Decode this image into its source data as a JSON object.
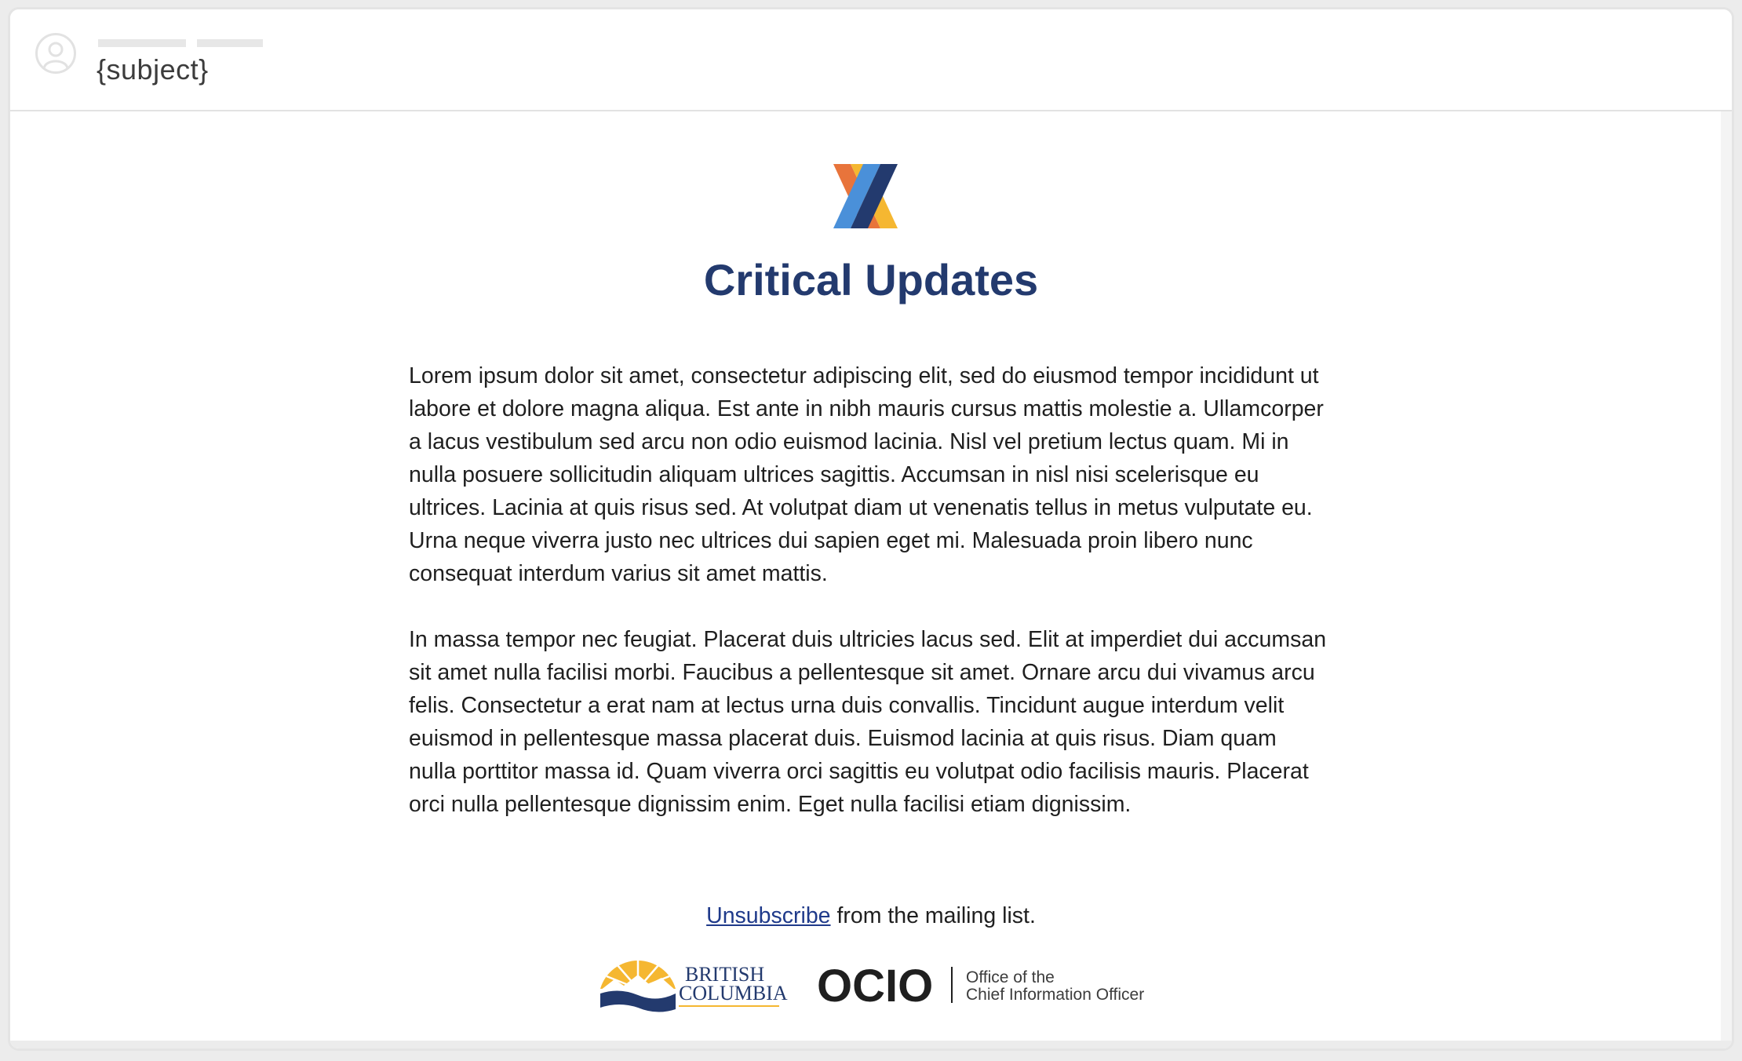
{
  "email": {
    "subject": "{subject}"
  },
  "content": {
    "title": "Critical Updates",
    "paragraphs": [
      "Lorem ipsum dolor sit amet, consectetur adipiscing elit, sed do eiusmod tempor incididunt ut labore et dolore magna aliqua. Est ante in nibh mauris cursus mattis molestie a. Ullamcorper a lacus vestibulum sed arcu non odio euismod lacinia. Nisl vel pretium lectus quam. Mi in nulla posuere sollicitudin aliquam ultrices sagittis. Accumsan in nisl nisi scelerisque eu ultrices. Lacinia at quis risus sed. At volutpat diam ut venenatis tellus in metus vulputate eu. Urna neque viverra justo nec ultrices dui sapien eget mi. Malesuada proin libero nunc consequat interdum varius sit amet mattis.",
      "In massa tempor nec feugiat. Placerat duis ultricies lacus sed. Elit at imperdiet dui accumsan sit amet nulla facilisi morbi. Faucibus a pellentesque sit amet. Ornare arcu dui vivamus arcu felis. Consectetur a erat nam at lectus urna duis convallis. Tincidunt augue interdum velit euismod in pellentesque massa placerat duis. Euismod lacinia at quis risus. Diam quam nulla porttitor massa id. Quam viverra orci sagittis eu volutpat odio facilisis mauris. Placerat orci nulla pellentesque dignissim enim. Eget nulla facilisi etiam dignissim."
    ]
  },
  "footer": {
    "unsubscribe_link": "Unsubscribe",
    "unsubscribe_suffix": " from the mailing list.",
    "bc_logo_line1": "BRITISH",
    "bc_logo_line2": "COLUMBIA",
    "ocio_acronym": "OCIO",
    "ocio_line1": "Office of the",
    "ocio_line2": "Chief Information Officer"
  },
  "colors": {
    "title": "#233a6e",
    "link": "#1f3a8a",
    "logo_orange": "#e8743b",
    "logo_blue": "#4a90d9",
    "logo_yellow": "#f5b731",
    "logo_navy": "#233a6e"
  },
  "icons": {
    "avatar": "user-avatar-icon",
    "brand": "x-brand-logo",
    "bc": "british-columbia-logo",
    "ocio": "ocio-logo"
  }
}
